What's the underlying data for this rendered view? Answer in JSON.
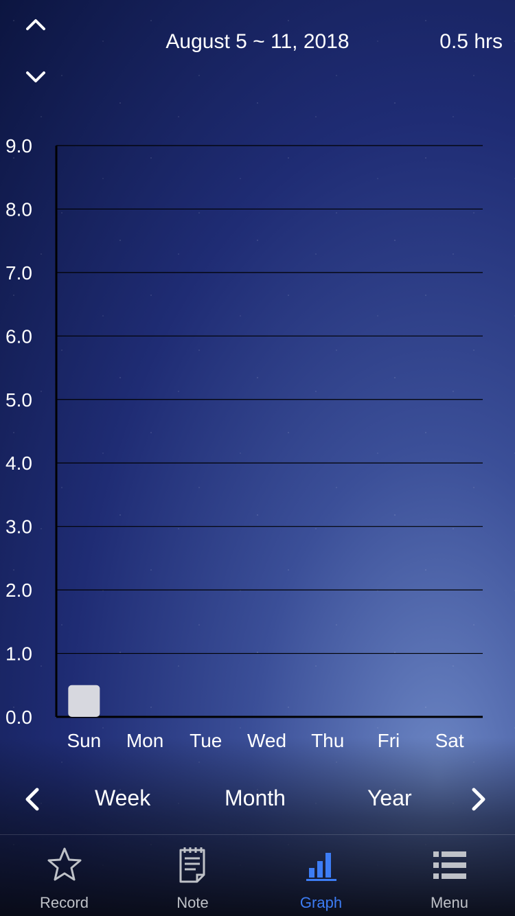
{
  "header": {
    "date_range": "August 5 ~ 11, 2018",
    "total": "0.5 hrs"
  },
  "chart_data": {
    "type": "bar",
    "categories": [
      "Sun",
      "Mon",
      "Tue",
      "Wed",
      "Thu",
      "Fri",
      "Sat"
    ],
    "values": [
      0.5,
      0,
      0,
      0,
      0,
      0,
      0
    ],
    "ylim": [
      0,
      9
    ],
    "yticks": [
      "0.0",
      "1.0",
      "2.0",
      "3.0",
      "4.0",
      "5.0",
      "6.0",
      "7.0",
      "8.0",
      "9.0"
    ],
    "grid": true,
    "bar_color": "#d7d8df"
  },
  "period_tabs": {
    "week": "Week",
    "month": "Month",
    "year": "Year"
  },
  "tabbar": {
    "items": [
      {
        "label": "Record",
        "icon": "star-icon"
      },
      {
        "label": "Note",
        "icon": "note-icon"
      },
      {
        "label": "Graph",
        "icon": "bar-chart-icon"
      },
      {
        "label": "Menu",
        "icon": "menu-icon"
      }
    ],
    "active_color": "#3d7df5"
  }
}
